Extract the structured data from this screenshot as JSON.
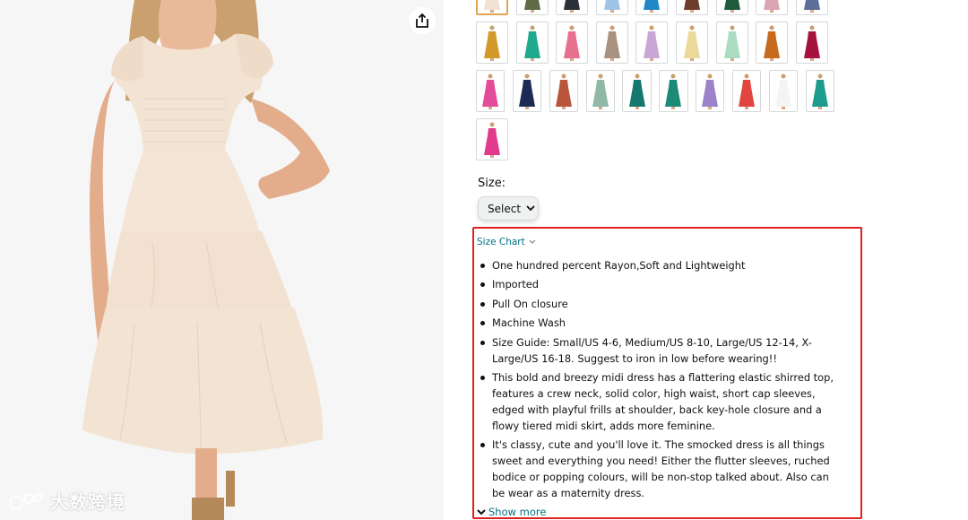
{
  "product_image": {
    "share_icon": "share-icon",
    "dress_color": "#f3e3d3"
  },
  "watermark": {
    "text": "大数跨境",
    "icon": "watermark-logo-icon"
  },
  "swatches": {
    "rows": [
      [
        "#f1e2d2",
        "#5e6b46",
        "#2b2f36",
        "#9fc3e4",
        "#1f86c8",
        "#6b3d2a",
        "#1e5a3c",
        "#d9a7b4",
        "#5d6f96"
      ],
      [
        "#d19a2a",
        "#1fa98d",
        "#e8708f",
        "#a8917e",
        "#c9a6d6",
        "#ecd99a",
        "#a9dcc0",
        "#c86a1e",
        "#a5123d"
      ],
      [
        "#e44c99",
        "#1c2a55",
        "#b8553a",
        "#8fb8a6",
        "#15786e",
        "#1d8a76",
        "#9c82c8",
        "#e0453f",
        "#f4f4f2",
        "#1c9b8e"
      ],
      [
        "#e23a8c"
      ]
    ],
    "selected_index": 0
  },
  "size": {
    "label": "Size:",
    "select_value": "Select"
  },
  "details": {
    "size_chart_label": "Size Chart",
    "bullets": [
      "One hundred percent Rayon,Soft and Lightweight",
      "Imported",
      "Pull On closure",
      "Machine Wash",
      "Size Guide: Small/US 4-6, Medium/US 8-10, Large/US 12-14, X-Large/US 16-18. Suggest to iron in low before wearing!!",
      "This bold and breezy midi dress has a flattering elastic shirred top, features a crew neck, solid color, high waist, short cap sleeves, edged with playful frills at shoulder, back key-hole closure and a flowy tiered midi skirt, adds more feminine.",
      "It's classy, cute and you'll love it. The smocked dress is all things sweet and everything you need! Either the flutter sleeves, ruched bodice or popping colours, will be non-stop talked about. Also can be wear as a maternity dress."
    ],
    "show_more_label": "Show more",
    "highlight_color": "#e0201f"
  },
  "colors": {
    "link": "#007185",
    "text": "#0f1111"
  }
}
